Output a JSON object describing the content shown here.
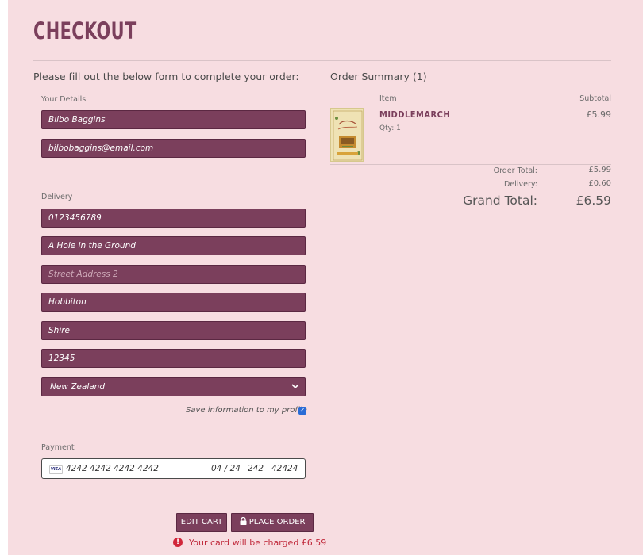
{
  "header": {
    "title": "CHECKOUT"
  },
  "form": {
    "intro": "Please fill out the below form to complete your order:",
    "your_details_label": "Your Details",
    "full_name": "Bilbo Baggins",
    "email": "bilbobaggins@email.com",
    "delivery_label": "Delivery",
    "phone": "0123456789",
    "street_address_1": "A Hole in the Ground",
    "street_address_2_placeholder": "Street Address 2",
    "town": "Hobbiton",
    "county": "Shire",
    "postcode": "12345",
    "country": "New Zealand",
    "save_info_label": "Save information to my profile",
    "save_info_checked": true,
    "payment_label": "Payment",
    "card": {
      "brand": "VISA",
      "number": "4242 4242 4242 4242",
      "expiry": "04 / 24",
      "cvc": "242",
      "zip": "42424"
    },
    "edit_cart_label": "EDIT CART",
    "place_order_label": "PLACE ORDER",
    "charge_message": "Your card will be charged £6.59"
  },
  "summary": {
    "title": "Order Summary (1)",
    "item_header": "Item",
    "subtotal_header": "Subtotal",
    "items": [
      {
        "name": "MIDDLEMARCH",
        "qty": "Qty: 1",
        "subtotal": "£5.99"
      }
    ],
    "order_total_label": "Order Total:",
    "order_total": "£5.99",
    "delivery_label": "Delivery:",
    "delivery": "£0.60",
    "grand_total_label": "Grand Total:",
    "grand_total": "£6.59"
  },
  "colors": {
    "accent": "#7b3f5c",
    "background": "#f7dde1",
    "error": "#c0293b"
  },
  "icons": [
    "chevron-down-icon",
    "lock-icon",
    "error-icon",
    "checkmark-icon"
  ]
}
